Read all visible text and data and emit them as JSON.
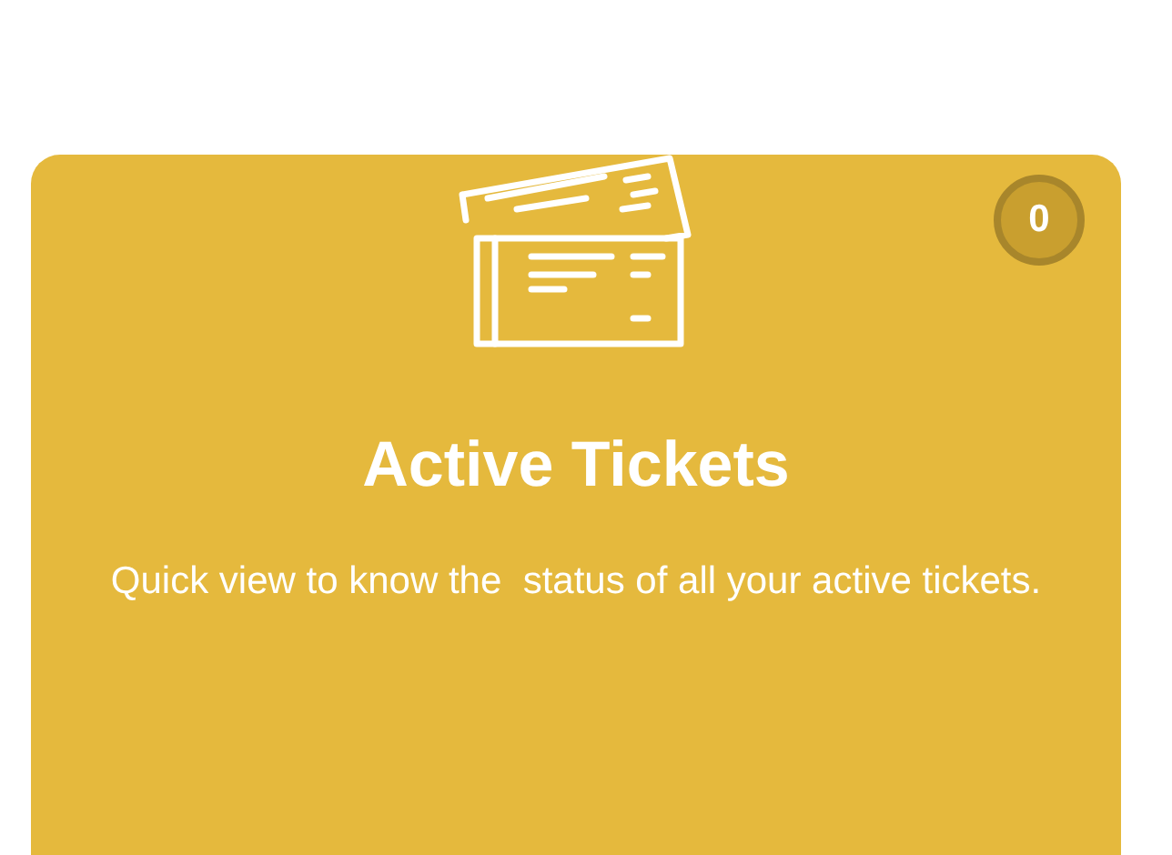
{
  "card": {
    "badge": "0",
    "title": "Active Tickets",
    "description": "Quick view to know the  status of all your active tickets."
  }
}
